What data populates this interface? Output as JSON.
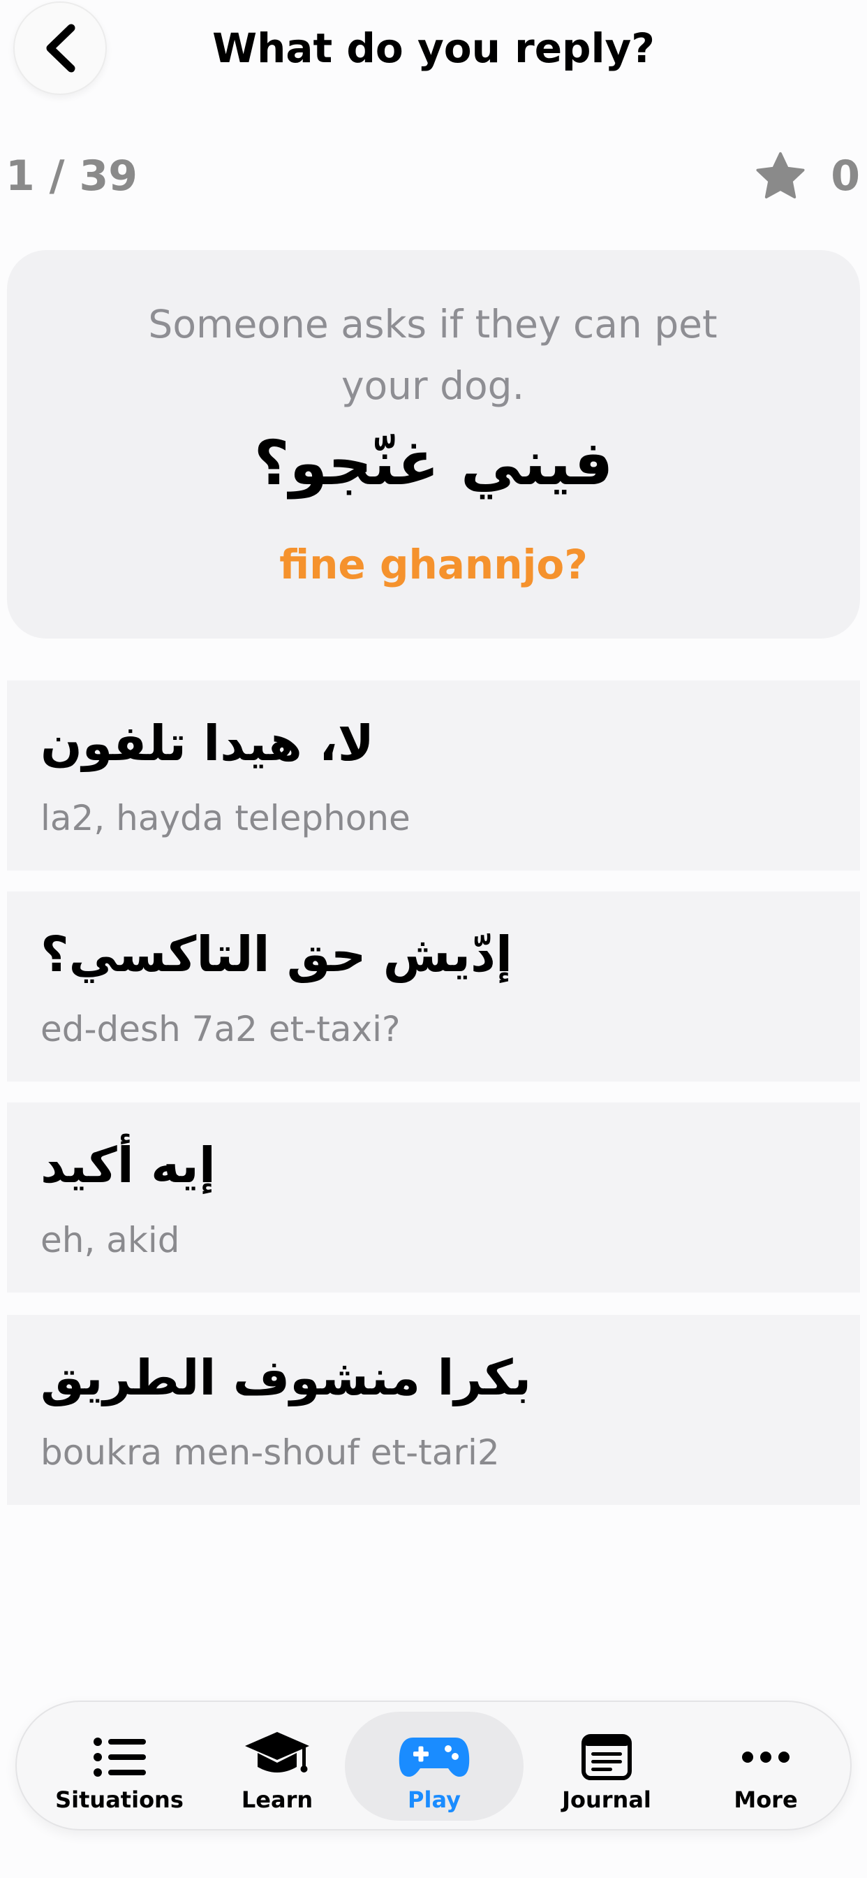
{
  "header": {
    "title": "What do you reply?",
    "back_icon": "chevron-left-icon"
  },
  "progress": {
    "current": "1 / 39"
  },
  "score": {
    "icon": "star-icon",
    "value": "0"
  },
  "prompt": {
    "situation": "Someone asks if they can pet your dog.",
    "arabic": "فيني غنّجو؟",
    "transliteration": "fine ghannjo?"
  },
  "options": [
    {
      "arabic": "لا، هيدا تلفون",
      "transliteration": "la2, hayda telephone"
    },
    {
      "arabic": "إدّيش حق التاكسي؟",
      "transliteration": "ed-desh 7a2 et-taxi?"
    },
    {
      "arabic": "إيه أكيد",
      "transliteration": "eh, akid"
    },
    {
      "arabic": "بكرا منشوف الطريق",
      "transliteration": "boukra men-shouf et-tari2"
    }
  ],
  "tabbar": {
    "tabs": [
      {
        "label": "Situations",
        "icon": "list-icon"
      },
      {
        "label": "Learn",
        "icon": "graduation-cap-icon"
      },
      {
        "label": "Play",
        "icon": "gamepad-icon",
        "active": true
      },
      {
        "label": "Journal",
        "icon": "journal-icon"
      },
      {
        "label": "More",
        "icon": "ellipsis-icon"
      }
    ]
  },
  "colors": {
    "accent": "#1a8cff",
    "transliteration": "#f5922d",
    "muted_text": "#8a8a8a",
    "card_background": "#f1f1f3"
  }
}
